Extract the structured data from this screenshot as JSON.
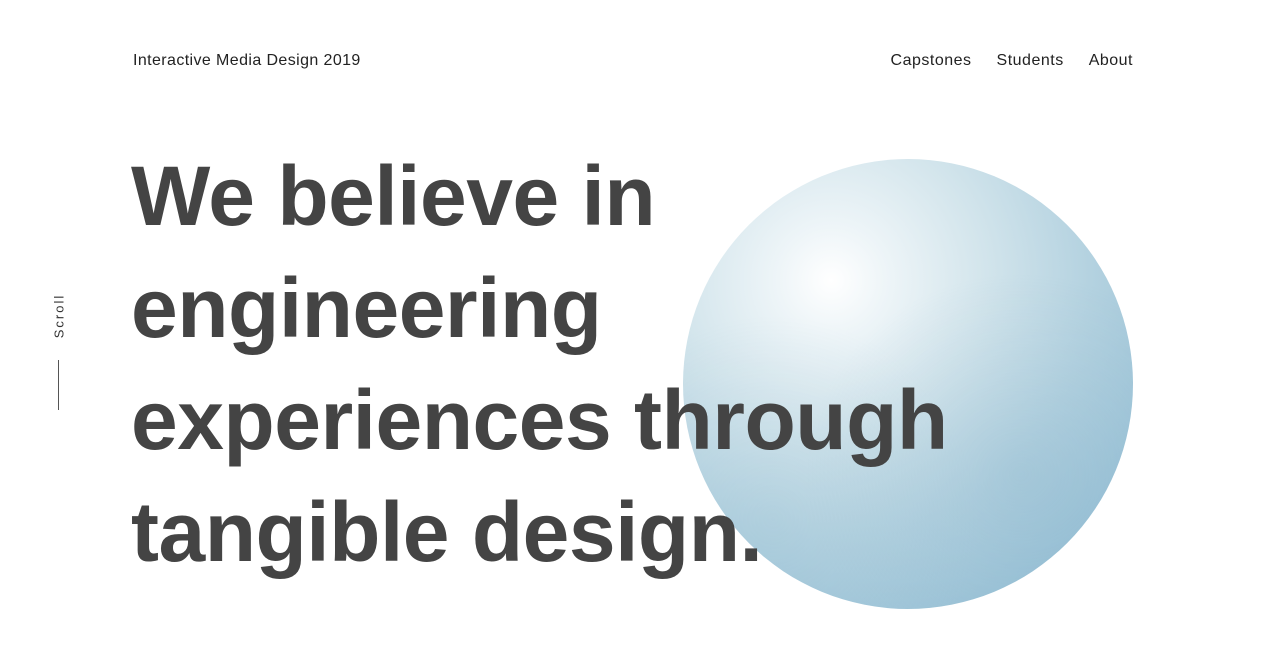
{
  "header": {
    "site_title": "Interactive Media Design 2019",
    "nav": {
      "capstones": "Capstones",
      "students": "Students",
      "about": "About"
    }
  },
  "hero": {
    "lines": [
      "We believe in",
      "engineering",
      "experiences through",
      "tangible design."
    ]
  },
  "scroll": {
    "label": "Scroll"
  },
  "colors": {
    "text": "#444444",
    "orb": "#a9cadb",
    "background": "#ffffff"
  }
}
